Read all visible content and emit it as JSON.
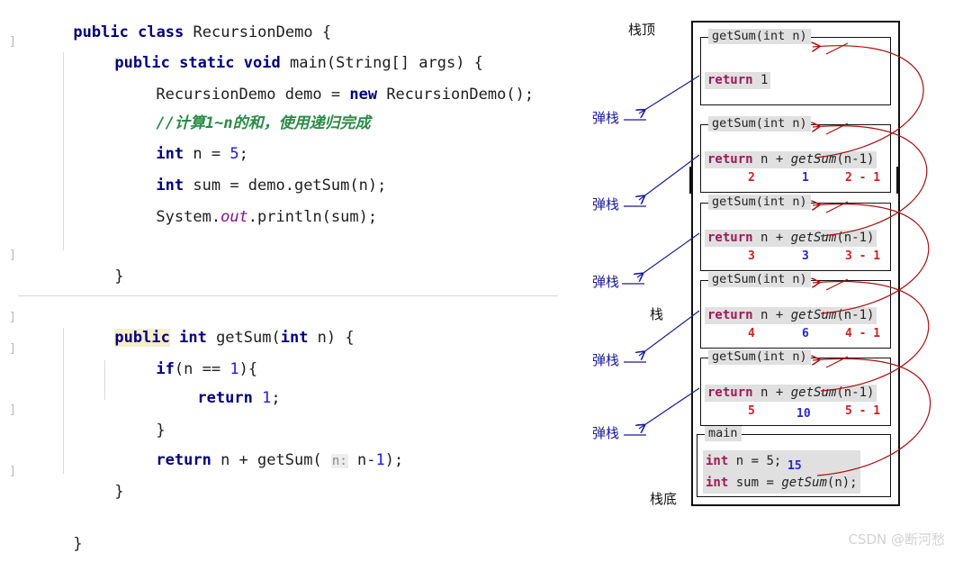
{
  "editor": {
    "code_lines": [
      {
        "indent": 0,
        "text": "public class RecursionDemo {"
      },
      {
        "indent": 1,
        "text": "public static void main(String[] args) {"
      },
      {
        "indent": 2,
        "text": "RecursionDemo demo = new RecursionDemo();"
      },
      {
        "indent": 2,
        "text": "//计算1~n的和，使用递归完成"
      },
      {
        "indent": 2,
        "text": "int n = 5;"
      },
      {
        "indent": 2,
        "text": "int sum = demo.getSum(n);"
      },
      {
        "indent": 2,
        "text": "System.out.println(sum);"
      },
      {
        "indent": 1,
        "text": "}"
      },
      {
        "indent": 1,
        "text": "public int getSum(int n) {"
      },
      {
        "indent": 2,
        "text": "if(n == 1){"
      },
      {
        "indent": 3,
        "text": "return 1;"
      },
      {
        "indent": 2,
        "text": "}"
      },
      {
        "indent": 2,
        "text": "return n + getSum( n: n-1);"
      },
      {
        "indent": 1,
        "text": "}"
      },
      {
        "indent": 0,
        "text": "}"
      }
    ],
    "parameter_hint": "n:",
    "fold_marker": "]",
    "highlighted_keyword": "public",
    "colors": {
      "keyword": "#000080",
      "number": "#1a1ae6",
      "comment": "#2a8a46",
      "static_field": "#871094",
      "highlight": "#f7eeca",
      "hint_bg": "#ededed"
    }
  },
  "stack_diagram": {
    "labels": {
      "top": "栈顶",
      "middle": "栈",
      "bottom": "栈底",
      "pop": "弹栈"
    },
    "pop_label_count": 5,
    "frames": [
      {
        "id": "frame-1",
        "title": "getSum(int n)",
        "body_prefix": "return",
        "body_rest": " 1",
        "annotations": null
      },
      {
        "id": "frame-2",
        "title": "getSum(int n)",
        "body_prefix": "return",
        "body_rest": " n + getSum(n-1)",
        "annotations": {
          "n_value": "2",
          "result": "1",
          "arg_expr": "2 - 1"
        }
      },
      {
        "id": "frame-3",
        "title": "getSum(int n)",
        "body_prefix": "return",
        "body_rest": " n + getSum(n-1)",
        "annotations": {
          "n_value": "3",
          "result": "3",
          "arg_expr": "3 - 1"
        }
      },
      {
        "id": "frame-4",
        "title": "getSum(int n)",
        "body_prefix": "return",
        "body_rest": " n + getSum(n-1)",
        "annotations": {
          "n_value": "4",
          "result": "6",
          "arg_expr": "4 - 1"
        }
      },
      {
        "id": "frame-5",
        "title": "getSum(int n)",
        "body_prefix": "return",
        "body_rest": " n + getSum(n-1)",
        "annotations": {
          "n_value": "5",
          "result": "10",
          "arg_expr": "5 - 1"
        }
      },
      {
        "id": "frame-main",
        "title": "main",
        "line_1": "int n = 5;",
        "line_2": "int sum = getSum(n);",
        "annotations": {
          "result": "15"
        }
      }
    ],
    "colors": {
      "pop_arrow": "#1a1a99",
      "return_arrow": "#aa1111",
      "frame_header_bg": "#e0e0e0",
      "frame_border": "#111111",
      "annotation_red": "#d32020",
      "annotation_blue": "#2727cf"
    }
  },
  "watermark": {
    "text": "CSDN @断河愁"
  }
}
